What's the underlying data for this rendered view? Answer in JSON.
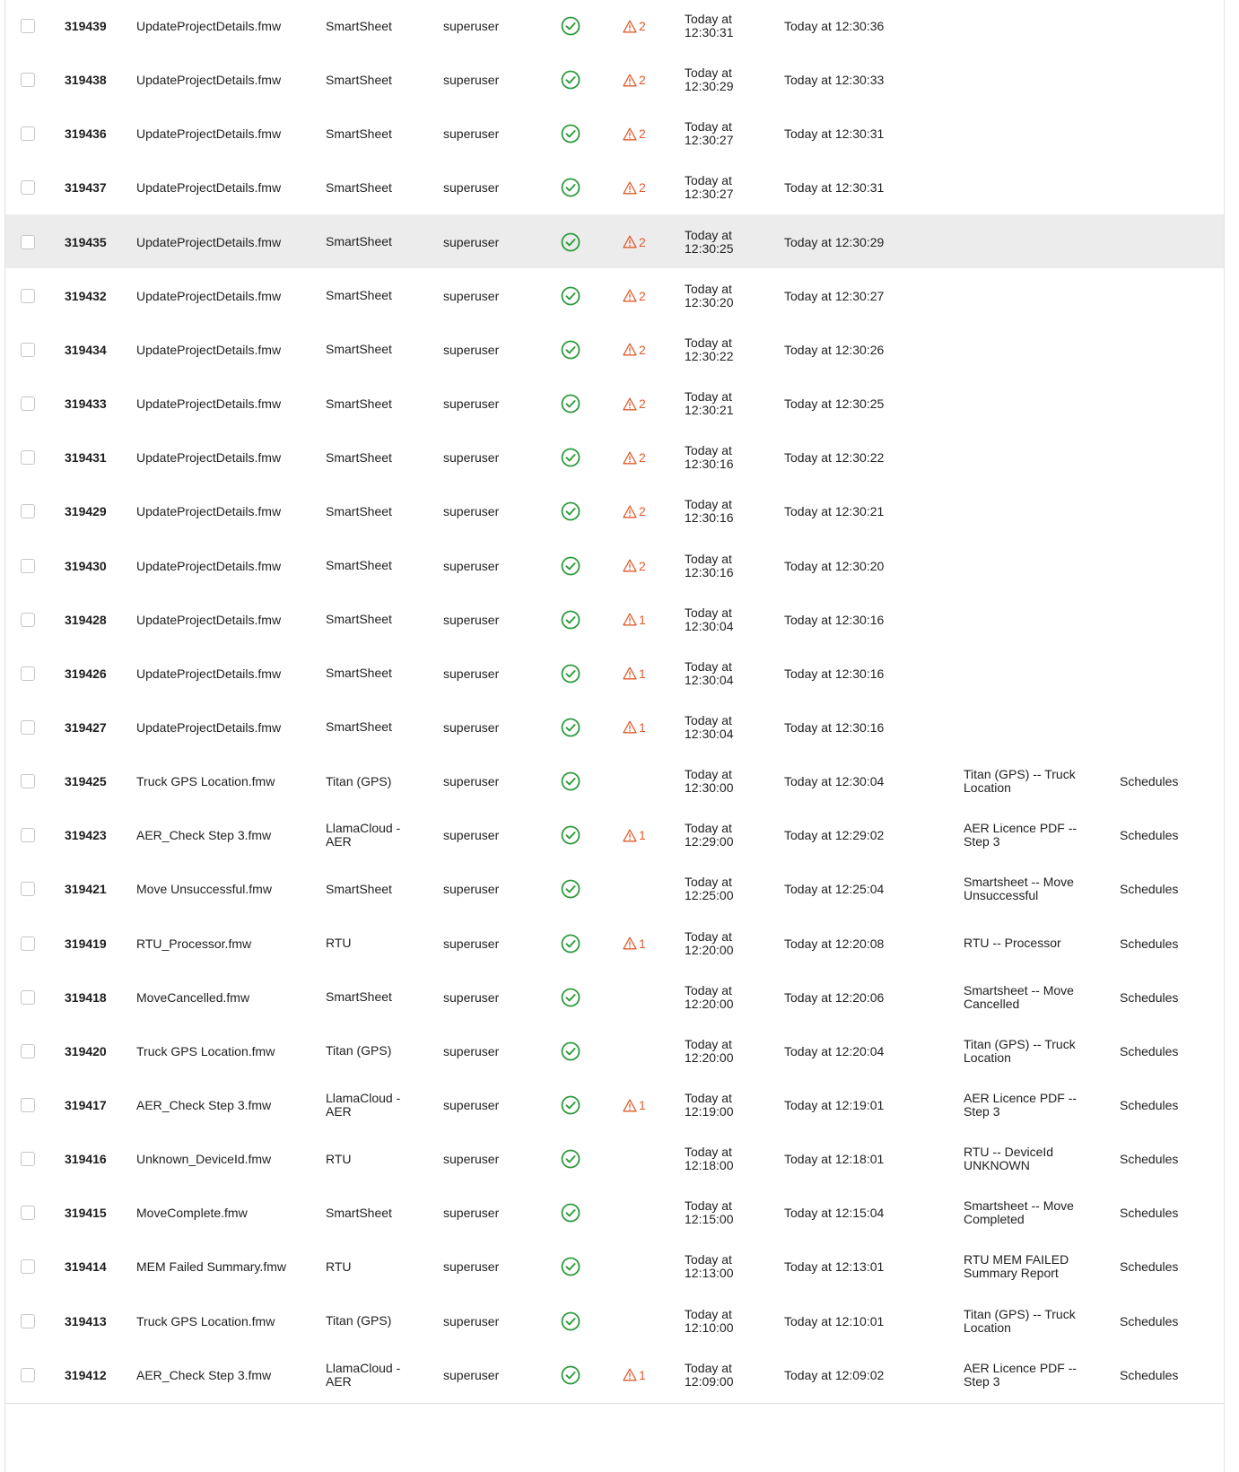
{
  "colors": {
    "success": "#2e9a3d",
    "warning": "#e05a2b",
    "row_hover": "#ececec",
    "divider": "#dcdcdc"
  },
  "icons": {
    "status": "check-circle-icon",
    "warning": "warning-triangle-icon",
    "select": "checkbox"
  },
  "jobs": [
    {
      "id": "319439",
      "workspace": "UpdateProjectDetails.fmw",
      "repo": [
        "SmartSheet"
      ],
      "user": "superuser",
      "warnings": "2",
      "queued": [
        "Today at",
        "12:30:31"
      ],
      "finished": "Today at 12:30:36",
      "source": [],
      "type": ""
    },
    {
      "id": "319438",
      "workspace": "UpdateProjectDetails.fmw",
      "repo": [
        "SmartSheet"
      ],
      "user": "superuser",
      "warnings": "2",
      "queued": [
        "Today at",
        "12:30:29"
      ],
      "finished": "Today at 12:30:33",
      "source": [],
      "type": ""
    },
    {
      "id": "319436",
      "workspace": "UpdateProjectDetails.fmw",
      "repo": [
        "SmartSheet"
      ],
      "user": "superuser",
      "warnings": "2",
      "queued": [
        "Today at",
        "12:30:27"
      ],
      "finished": "Today at 12:30:31",
      "source": [],
      "type": ""
    },
    {
      "id": "319437",
      "workspace": "UpdateProjectDetails.fmw",
      "repo": [
        "SmartSheet"
      ],
      "user": "superuser",
      "warnings": "2",
      "queued": [
        "Today at",
        "12:30:27"
      ],
      "finished": "Today at 12:30:31",
      "source": [],
      "type": ""
    },
    {
      "id": "319435",
      "workspace": "UpdateProjectDetails.fmw",
      "repo": [
        "SmartSheet"
      ],
      "user": "superuser",
      "warnings": "2",
      "queued": [
        "Today at",
        "12:30:25"
      ],
      "finished": "Today at 12:30:29",
      "source": [],
      "type": "",
      "hover": true
    },
    {
      "id": "319432",
      "workspace": "UpdateProjectDetails.fmw",
      "repo": [
        "SmartSheet"
      ],
      "user": "superuser",
      "warnings": "2",
      "queued": [
        "Today at",
        "12:30:20"
      ],
      "finished": "Today at 12:30:27",
      "source": [],
      "type": ""
    },
    {
      "id": "319434",
      "workspace": "UpdateProjectDetails.fmw",
      "repo": [
        "SmartSheet"
      ],
      "user": "superuser",
      "warnings": "2",
      "queued": [
        "Today at",
        "12:30:22"
      ],
      "finished": "Today at 12:30:26",
      "source": [],
      "type": ""
    },
    {
      "id": "319433",
      "workspace": "UpdateProjectDetails.fmw",
      "repo": [
        "SmartSheet"
      ],
      "user": "superuser",
      "warnings": "2",
      "queued": [
        "Today at",
        "12:30:21"
      ],
      "finished": "Today at 12:30:25",
      "source": [],
      "type": ""
    },
    {
      "id": "319431",
      "workspace": "UpdateProjectDetails.fmw",
      "repo": [
        "SmartSheet"
      ],
      "user": "superuser",
      "warnings": "2",
      "queued": [
        "Today at",
        "12:30:16"
      ],
      "finished": "Today at 12:30:22",
      "source": [],
      "type": ""
    },
    {
      "id": "319429",
      "workspace": "UpdateProjectDetails.fmw",
      "repo": [
        "SmartSheet"
      ],
      "user": "superuser",
      "warnings": "2",
      "queued": [
        "Today at",
        "12:30:16"
      ],
      "finished": "Today at 12:30:21",
      "source": [],
      "type": ""
    },
    {
      "id": "319430",
      "workspace": "UpdateProjectDetails.fmw",
      "repo": [
        "SmartSheet"
      ],
      "user": "superuser",
      "warnings": "2",
      "queued": [
        "Today at",
        "12:30:16"
      ],
      "finished": "Today at 12:30:20",
      "source": [],
      "type": ""
    },
    {
      "id": "319428",
      "workspace": "UpdateProjectDetails.fmw",
      "repo": [
        "SmartSheet"
      ],
      "user": "superuser",
      "warnings": "1",
      "queued": [
        "Today at",
        "12:30:04"
      ],
      "finished": "Today at 12:30:16",
      "source": [],
      "type": ""
    },
    {
      "id": "319426",
      "workspace": "UpdateProjectDetails.fmw",
      "repo": [
        "SmartSheet"
      ],
      "user": "superuser",
      "warnings": "1",
      "queued": [
        "Today at",
        "12:30:04"
      ],
      "finished": "Today at 12:30:16",
      "source": [],
      "type": ""
    },
    {
      "id": "319427",
      "workspace": "UpdateProjectDetails.fmw",
      "repo": [
        "SmartSheet"
      ],
      "user": "superuser",
      "warnings": "1",
      "queued": [
        "Today at",
        "12:30:04"
      ],
      "finished": "Today at 12:30:16",
      "source": [],
      "type": ""
    },
    {
      "id": "319425",
      "workspace": "Truck GPS Location.fmw",
      "repo": [
        "Titan (GPS)"
      ],
      "user": "superuser",
      "warnings": "",
      "queued": [
        "Today at",
        "12:30:00"
      ],
      "finished": "Today at 12:30:04",
      "source": [
        "Titan (GPS) -- Truck",
        "Location"
      ],
      "type": "Schedules"
    },
    {
      "id": "319423",
      "workspace": "AER_Check Step 3.fmw",
      "repo": [
        "LlamaCloud -",
        "AER"
      ],
      "user": "superuser",
      "warnings": "1",
      "queued": [
        "Today at",
        "12:29:00"
      ],
      "finished": "Today at 12:29:02",
      "source": [
        "AER Licence PDF --",
        "Step 3"
      ],
      "type": "Schedules"
    },
    {
      "id": "319421",
      "workspace": "Move Unsuccessful.fmw",
      "repo": [
        "SmartSheet"
      ],
      "user": "superuser",
      "warnings": "",
      "queued": [
        "Today at",
        "12:25:00"
      ],
      "finished": "Today at 12:25:04",
      "source": [
        "Smartsheet -- Move",
        "Unsuccessful"
      ],
      "type": "Schedules"
    },
    {
      "id": "319419",
      "workspace": "RTU_Processor.fmw",
      "repo": [
        "RTU"
      ],
      "user": "superuser",
      "warnings": "1",
      "queued": [
        "Today at",
        "12:20:00"
      ],
      "finished": "Today at 12:20:08",
      "source": [
        "RTU -- Processor"
      ],
      "type": "Schedules"
    },
    {
      "id": "319418",
      "workspace": "MoveCancelled.fmw",
      "repo": [
        "SmartSheet"
      ],
      "user": "superuser",
      "warnings": "",
      "queued": [
        "Today at",
        "12:20:00"
      ],
      "finished": "Today at 12:20:06",
      "source": [
        "Smartsheet -- Move",
        "Cancelled"
      ],
      "type": "Schedules"
    },
    {
      "id": "319420",
      "workspace": "Truck GPS Location.fmw",
      "repo": [
        "Titan (GPS)"
      ],
      "user": "superuser",
      "warnings": "",
      "queued": [
        "Today at",
        "12:20:00"
      ],
      "finished": "Today at 12:20:04",
      "source": [
        "Titan (GPS) -- Truck",
        "Location"
      ],
      "type": "Schedules"
    },
    {
      "id": "319417",
      "workspace": "AER_Check Step 3.fmw",
      "repo": [
        "LlamaCloud -",
        "AER"
      ],
      "user": "superuser",
      "warnings": "1",
      "queued": [
        "Today at",
        "12:19:00"
      ],
      "finished": "Today at 12:19:01",
      "source": [
        "AER Licence PDF --",
        "Step 3"
      ],
      "type": "Schedules"
    },
    {
      "id": "319416",
      "workspace": "Unknown_DeviceId.fmw",
      "repo": [
        "RTU"
      ],
      "user": "superuser",
      "warnings": "",
      "queued": [
        "Today at",
        "12:18:00"
      ],
      "finished": "Today at 12:18:01",
      "source": [
        "RTU -- DeviceId",
        "UNKNOWN"
      ],
      "type": "Schedules"
    },
    {
      "id": "319415",
      "workspace": "MoveComplete.fmw",
      "repo": [
        "SmartSheet"
      ],
      "user": "superuser",
      "warnings": "",
      "queued": [
        "Today at",
        "12:15:00"
      ],
      "finished": "Today at 12:15:04",
      "source": [
        "Smartsheet -- Move",
        "Completed"
      ],
      "type": "Schedules"
    },
    {
      "id": "319414",
      "workspace": "MEM Failed Summary.fmw",
      "repo": [
        "RTU"
      ],
      "user": "superuser",
      "warnings": "",
      "queued": [
        "Today at",
        "12:13:00"
      ],
      "finished": "Today at 12:13:01",
      "source": [
        "RTU MEM FAILED",
        "Summary Report"
      ],
      "type": "Schedules"
    },
    {
      "id": "319413",
      "workspace": "Truck GPS Location.fmw",
      "repo": [
        "Titan (GPS)"
      ],
      "user": "superuser",
      "warnings": "",
      "queued": [
        "Today at",
        "12:10:00"
      ],
      "finished": "Today at 12:10:01",
      "source": [
        "Titan (GPS) -- Truck",
        "Location"
      ],
      "type": "Schedules"
    },
    {
      "id": "319412",
      "workspace": "AER_Check Step 3.fmw",
      "repo": [
        "LlamaCloud -",
        "AER"
      ],
      "user": "superuser",
      "warnings": "1",
      "queued": [
        "Today at",
        "12:09:00"
      ],
      "finished": "Today at 12:09:02",
      "source": [
        "AER Licence PDF --",
        "Step 3"
      ],
      "type": "Schedules"
    }
  ]
}
